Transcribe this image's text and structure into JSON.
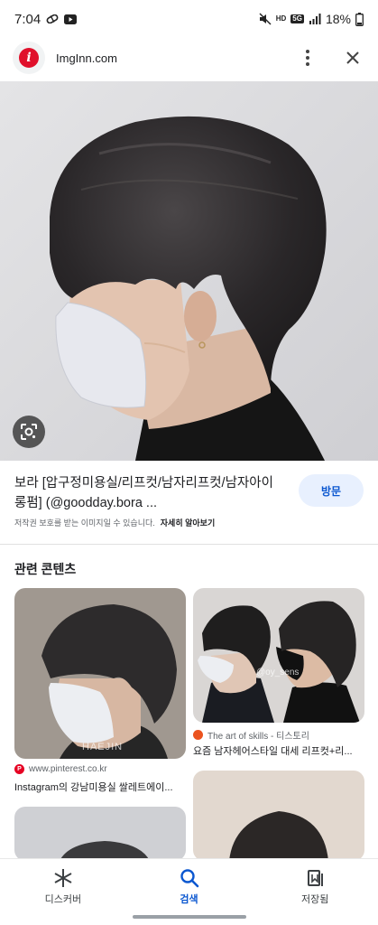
{
  "status_bar": {
    "time": "7:04",
    "battery": "18%",
    "network_top": "HD",
    "network_bottom": "5G"
  },
  "url_bar": {
    "domain": "ImgInn.com",
    "site_icon_letter": "i"
  },
  "result": {
    "title": "보라 [압구정미용실/리프컷/남자리프컷/남자아이롱펌] (@goodday.bora ...",
    "visit_label": "방문",
    "copyright_notice": "저작권 보호를 받는 이미지일 수 있습니다.",
    "learn_more": "자세히 알아보기"
  },
  "related": {
    "title": "관련 콘텐츠",
    "cards": [
      {
        "source": "www.pinterest.co.kr",
        "caption": "Instagram의 강남미용실 쌀레트에이...",
        "watermark": "HAEJIN",
        "source_icon": "pinterest-icon"
      },
      {
        "source": "The art of skills - 티스토리",
        "caption": "요즘 남자헤어스타일 대세 리프컷+리...",
        "watermark": "@oy_sens",
        "source_icon": "tistory-icon"
      }
    ]
  },
  "bottom_nav": {
    "items": [
      {
        "label": "디스커버",
        "icon": "asterisk-icon"
      },
      {
        "label": "검색",
        "icon": "search-icon"
      },
      {
        "label": "저장됨",
        "icon": "bookmark-icon"
      }
    ]
  },
  "colors": {
    "accent": "#0b57d0",
    "visit_bg": "#e8f0fe",
    "site_icon": "#e0102b"
  }
}
